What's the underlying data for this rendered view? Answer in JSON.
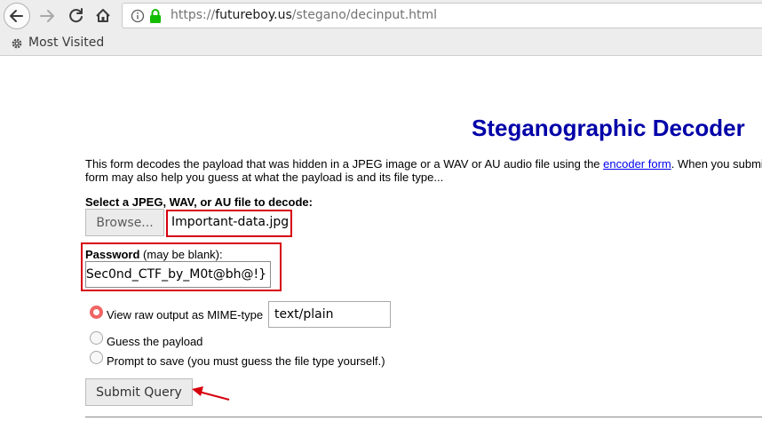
{
  "browser": {
    "url_prefix": "https://",
    "url_host": "futureboy.us",
    "url_path": "/stegano/decinput.html",
    "bookmark_label": "Most Visited"
  },
  "page": {
    "title": "Steganographic Decoder",
    "intro_line1_pre": "This form decodes the payload that was hidden in a JPEG image or a WAV or AU audio file using the ",
    "intro_link": "encoder form",
    "intro_line1_post": ". When you submit",
    "intro_line2": "form may also help you guess at what the payload is and its file type...",
    "file_label": "Select a JPEG, WAV, or AU file to decode:",
    "browse_label": "Browse...",
    "file_name": "Important-data.jpg",
    "password_label": "Password",
    "password_hint": " (may be blank):",
    "password_value": "Sec0nd_CTF_by_M0t@bh@!}",
    "options": [
      {
        "label": "View raw output as MIME-type",
        "checked": true
      },
      {
        "label": "Guess the payload",
        "checked": false
      },
      {
        "label": "Prompt to save (you must guess the file type yourself.)",
        "checked": false
      }
    ],
    "mime_value": "text/plain",
    "submit_label": "Submit Query"
  },
  "colors": {
    "title": "#0000a8",
    "annotation": "#d6000d",
    "radio_checked": "#f06464"
  }
}
